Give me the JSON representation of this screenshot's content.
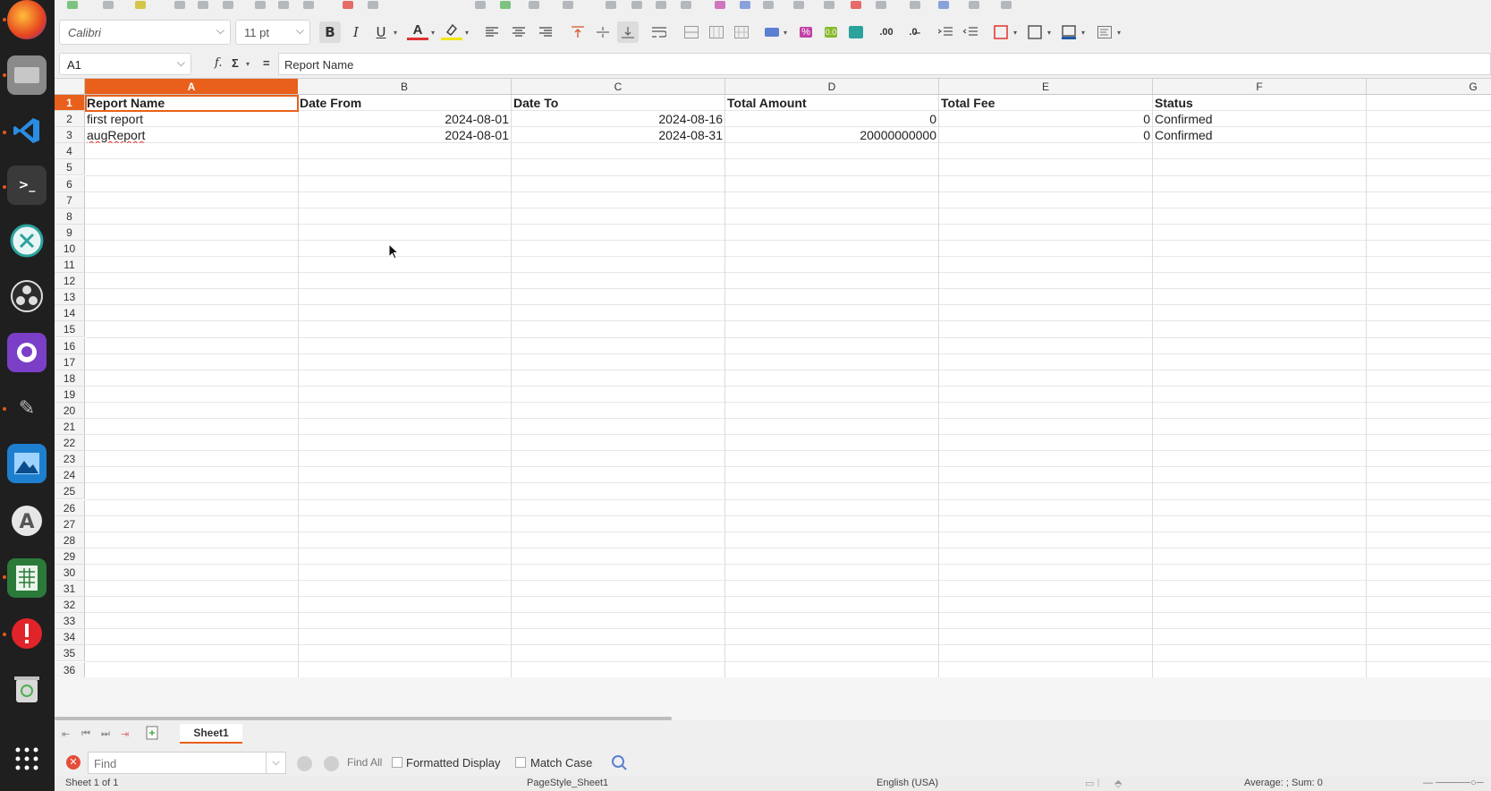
{
  "dock": {
    "items": [
      {
        "name": "firefox-icon"
      },
      {
        "name": "files-icon"
      },
      {
        "name": "vscode-icon"
      },
      {
        "name": "terminal-icon"
      },
      {
        "name": "remote-desktop-icon"
      },
      {
        "name": "obs-icon"
      },
      {
        "name": "github-icon"
      },
      {
        "name": "gimp-icon"
      },
      {
        "name": "image-viewer-icon"
      },
      {
        "name": "software-center-icon"
      },
      {
        "name": "calc-icon"
      },
      {
        "name": "alert-icon"
      },
      {
        "name": "trash-icon"
      },
      {
        "name": "app-grid-icon"
      }
    ]
  },
  "toolbar": {
    "font_name": "Calibri",
    "font_size": "11 pt",
    "bold": "B",
    "italic": "I",
    "underline": "U",
    "font_color": "A",
    "highlight": "✎",
    "decimal_add": ".00",
    "decimal_remove": ".0̶",
    "percent": "%",
    "number_fmt": "0.0"
  },
  "formula_bar": {
    "name_box": "A1",
    "fx": "f.",
    "sum": "Σ",
    "equals": "=",
    "content": "Report Name"
  },
  "sheet": {
    "columns": [
      "A",
      "B",
      "C",
      "D",
      "E",
      "F",
      "G"
    ],
    "selected_column": "A",
    "selected_row": 1,
    "row_count": 38,
    "rows": [
      [
        "Report Name",
        "Date From",
        "Date To",
        "Total Amount",
        "Total Fee",
        "Status"
      ],
      [
        "first report",
        "2024-08-01",
        "2024-08-16",
        "0",
        "0",
        "Confirmed"
      ],
      [
        "augReport",
        "2024-08-01",
        "2024-08-31",
        "20000000000",
        "0",
        "Confirmed"
      ]
    ]
  },
  "tabs": {
    "sheet_name": "Sheet1"
  },
  "find": {
    "placeholder": "Find",
    "find_all": "Find All",
    "formatted_display": "Formatted Display",
    "match_case": "Match Case"
  },
  "status": {
    "sheet_info": "Sheet 1 of 1",
    "page_style": "PageStyle_Sheet1",
    "language": "English (USA)",
    "summary": "Average: ; Sum: 0"
  },
  "colors": {
    "accent": "#e8601b",
    "dock_bg": "#1f1f1f"
  }
}
